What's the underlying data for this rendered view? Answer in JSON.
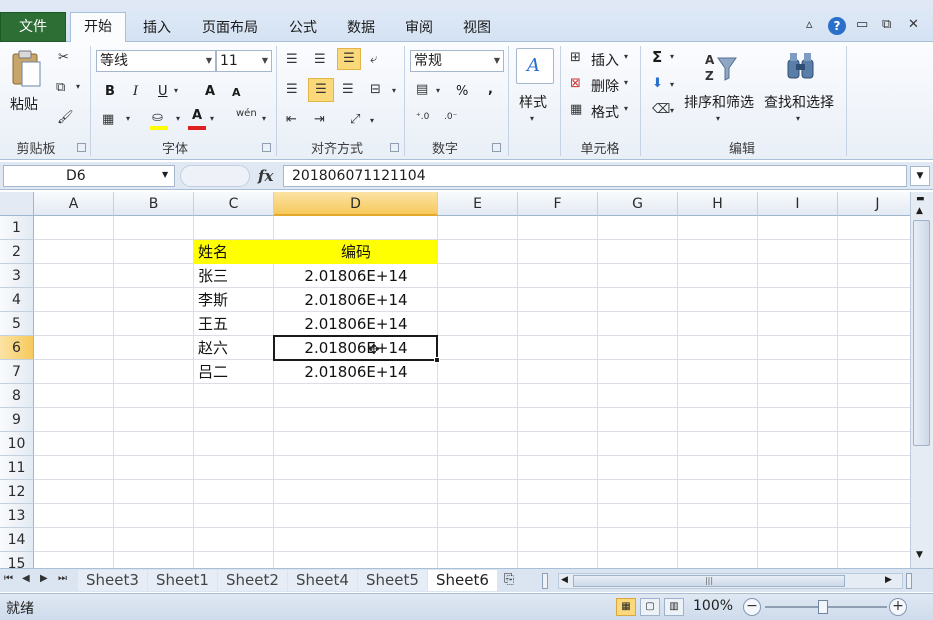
{
  "ribbon_tabs": {
    "file": "文件",
    "home": "开始",
    "insert": "插入",
    "page_layout": "页面布局",
    "formulas": "公式",
    "data": "数据",
    "review": "审阅",
    "view": "视图"
  },
  "clipboard": {
    "paste": "粘贴",
    "group": "剪贴板"
  },
  "font": {
    "name": "等线",
    "size": "11",
    "group": "字体",
    "bold": "B",
    "italic": "I",
    "underline": "U",
    "grow": "A",
    "shrink": "A",
    "phonetic": "wén"
  },
  "alignment": {
    "group": "对齐方式"
  },
  "number": {
    "format": "常规",
    "group": "数字",
    "percent": "%",
    "comma": ","
  },
  "styles": {
    "label": "样式"
  },
  "cells": {
    "insert": "插入",
    "delete": "删除",
    "format": "格式",
    "group": "单元格"
  },
  "editing": {
    "sort_filter": "排序和筛选",
    "find_select": "查找和选择",
    "group": "编辑",
    "sum": "Σ"
  },
  "formula_bar": {
    "name_box": "D6",
    "fx": "fx",
    "value": "201806071121104"
  },
  "columns": [
    "A",
    "B",
    "C",
    "D",
    "E",
    "F",
    "G",
    "H",
    "I",
    "J"
  ],
  "rows": [
    "1",
    "2",
    "3",
    "4",
    "5",
    "6",
    "7",
    "8",
    "9",
    "10",
    "11",
    "12",
    "13",
    "14",
    "15"
  ],
  "table": {
    "header_name": "姓名",
    "header_code": "编码",
    "rows": [
      {
        "name": "张三",
        "code": "2.01806E+14"
      },
      {
        "name": "李斯",
        "code": "2.01806E+14"
      },
      {
        "name": "王五",
        "code": "2.01806E+14"
      },
      {
        "name": "赵六",
        "code": "2.01806E+14"
      },
      {
        "name": "吕二",
        "code": "2.01806E+14"
      }
    ]
  },
  "sheets": [
    "Sheet3",
    "Sheet1",
    "Sheet2",
    "Sheet4",
    "Sheet5",
    "Sheet6"
  ],
  "active_sheet": "Sheet6",
  "status": {
    "ready": "就绪",
    "zoom": "100%"
  },
  "colors": {
    "header_fill": "#ffff00",
    "file_tab": "#2d6e34",
    "active_header": "#f6c95c"
  }
}
